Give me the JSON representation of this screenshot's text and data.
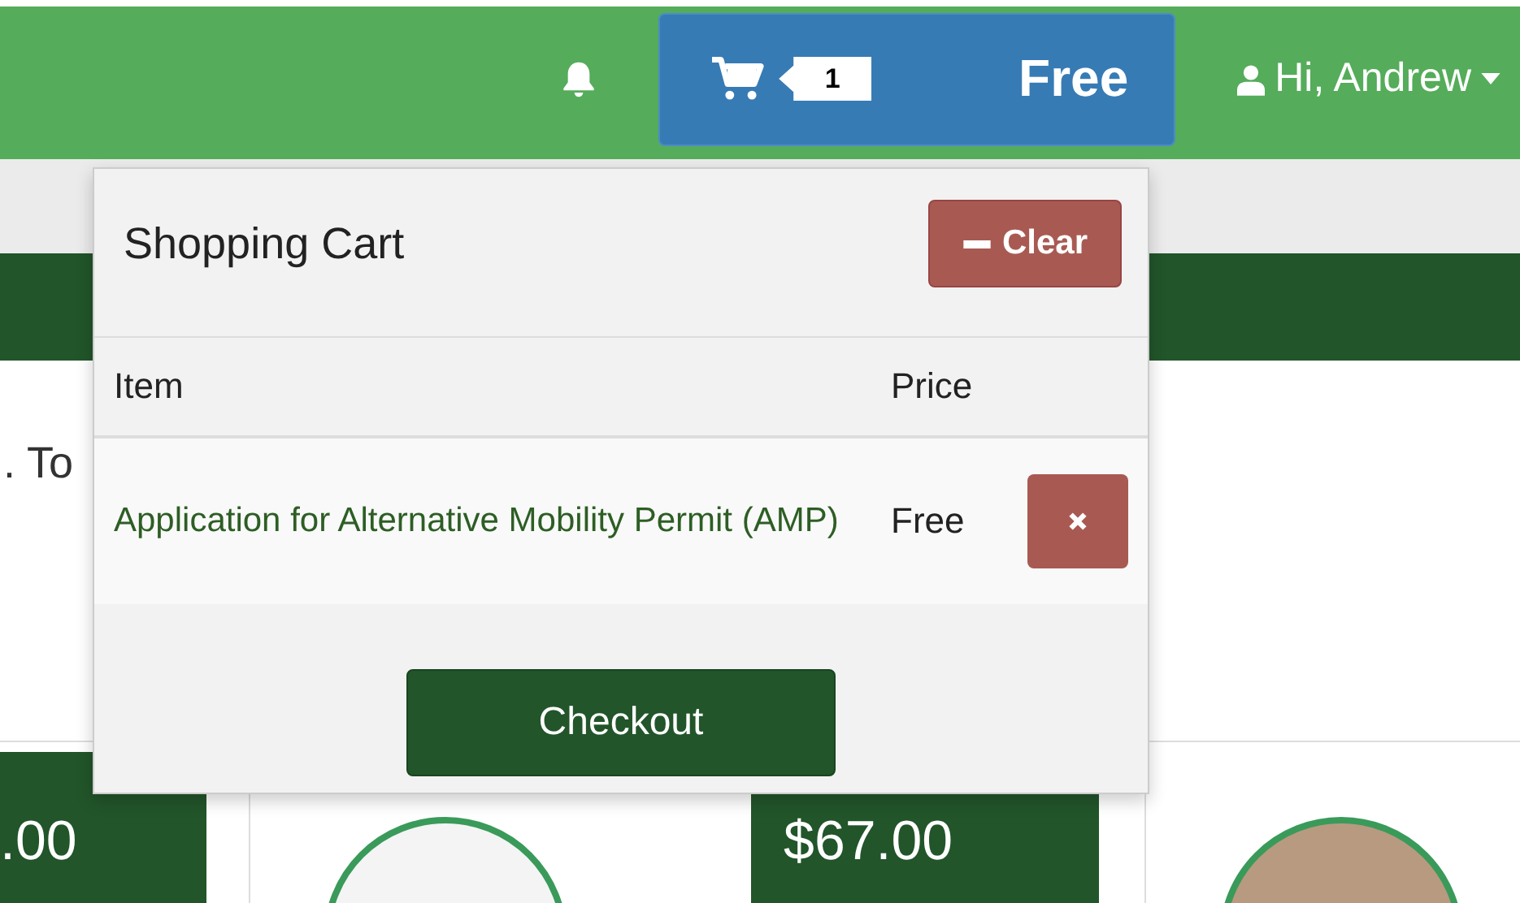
{
  "navbar": {
    "cart_count": "1",
    "cart_total": "Free",
    "user": "Hi, Andrew"
  },
  "content": {
    "text_fragment": ". To"
  },
  "cards": [
    {
      "price": ".00"
    },
    {
      "price": "$67.00"
    }
  ],
  "cart_dropdown": {
    "title": "Shopping Cart",
    "clear_button": "Clear",
    "columns": [
      "Item",
      "Price"
    ],
    "rows": [
      {
        "item": "Application for Alternative Mobility Permit (AMP)",
        "price": "Free"
      }
    ],
    "checkout_button": "Checkout"
  }
}
